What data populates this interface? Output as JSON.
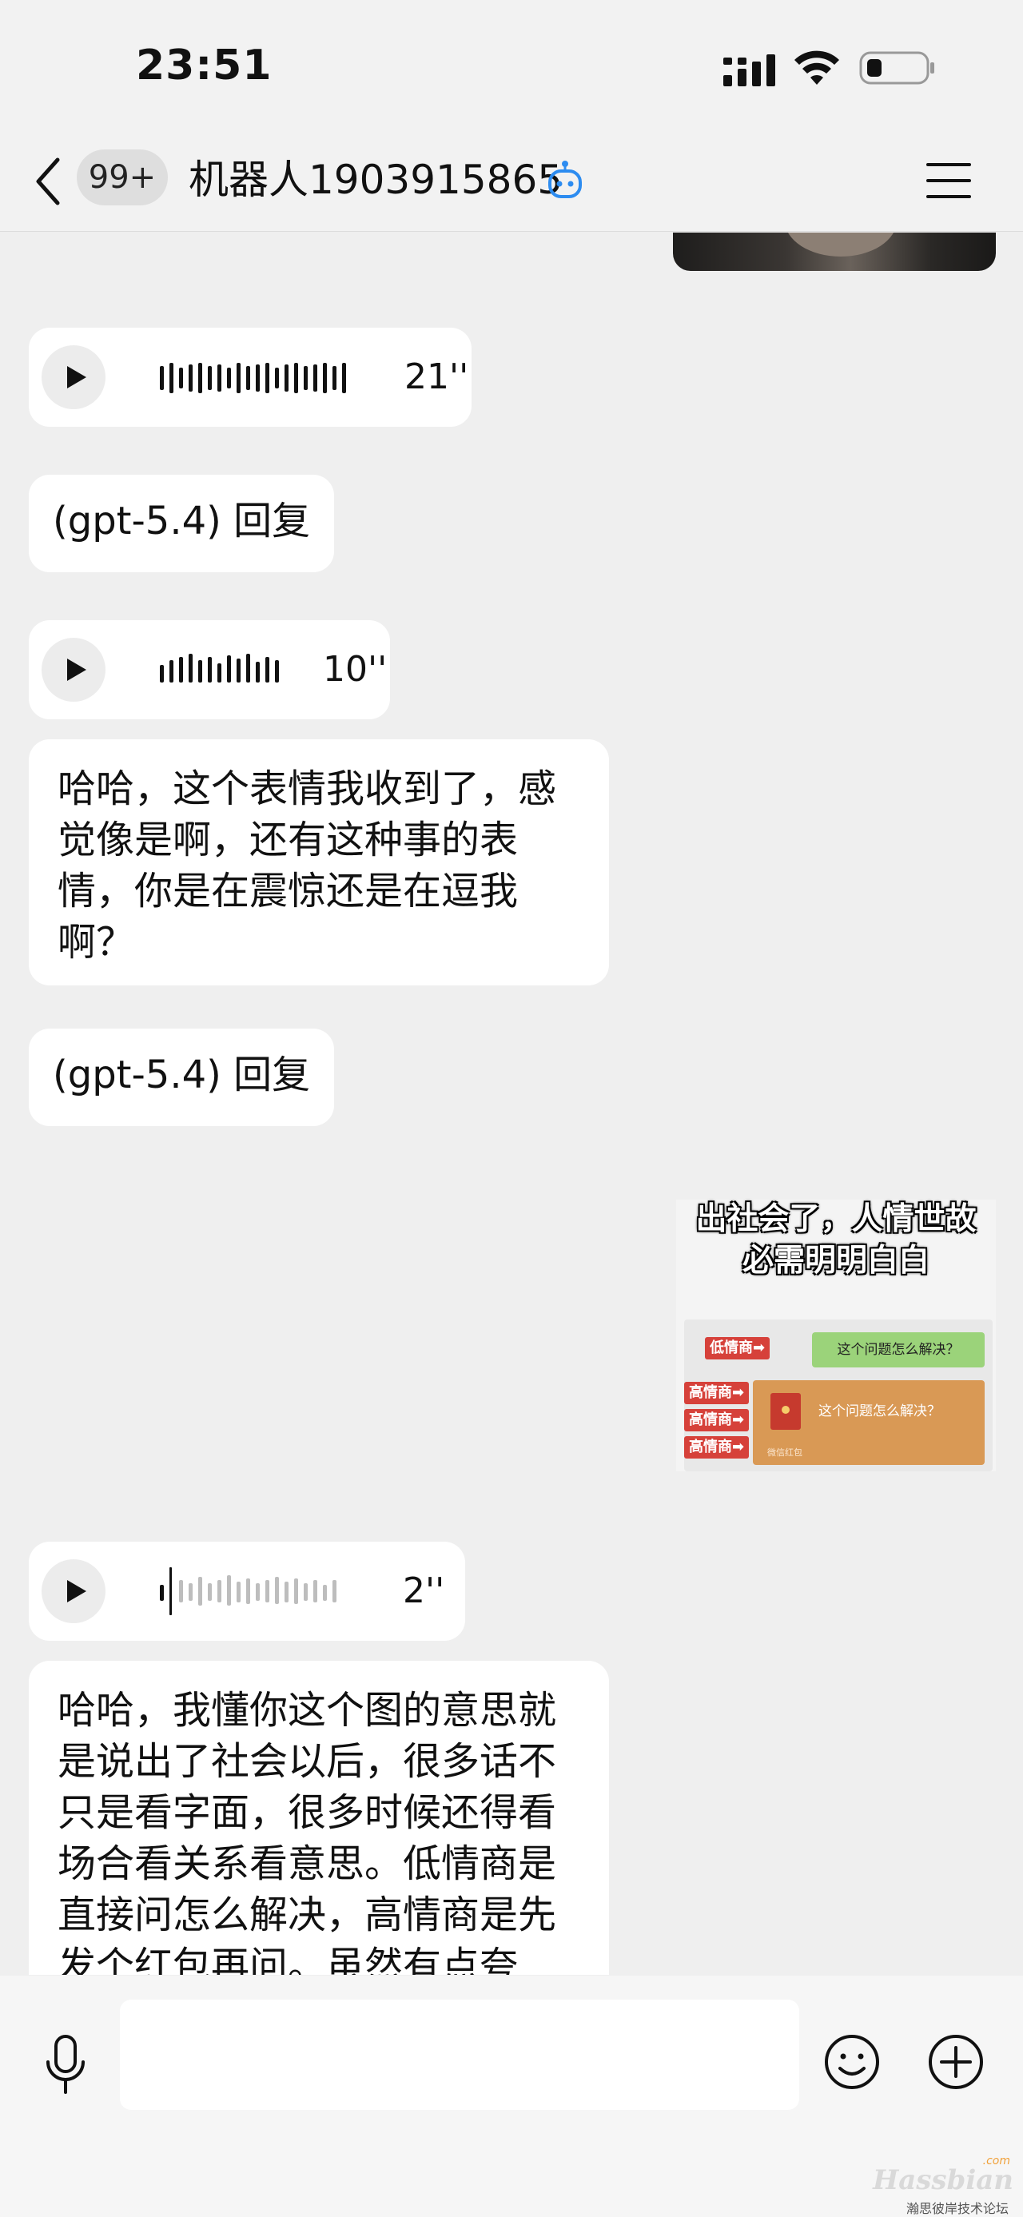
{
  "status_bar": {
    "time": "23:51"
  },
  "nav": {
    "unread_badge": "99+",
    "title": "机器人1903915865"
  },
  "messages": [
    {
      "kind": "voice",
      "duration": "21''"
    },
    {
      "kind": "text",
      "text": "(gpt-5.4) 回复"
    },
    {
      "kind": "voice",
      "duration": "10''"
    },
    {
      "kind": "text",
      "text": "哈哈，这个表情我收到了，感觉像是啊，还有这种事的表情，你是在震惊还是在逗我啊？"
    },
    {
      "kind": "text",
      "text": "(gpt-5.4) 回复"
    },
    {
      "kind": "voice",
      "duration": "2''"
    },
    {
      "kind": "text",
      "text": "哈哈，我懂你这个图的意思就是说出了社会以后，很多话不只是看字面，很多时候还得看场合看关系看意思。低情商是直接问怎么解决，高情商是先发个红包再问。虽然有点夸"
    }
  ],
  "meme": {
    "caption_line1": "出社会了，人情世故",
    "caption_line2": "必需明明白白",
    "low_eq_tag": "低情商➡",
    "high_eq_tag": "高情商➡",
    "question": "这个问题怎么解决？",
    "envelope_note": "微信红包"
  },
  "input": {
    "placeholder": ""
  },
  "watermark": {
    "brand": "Hassbian",
    "sub": "瀚思彼岸技术论坛",
    "com": ".com"
  }
}
